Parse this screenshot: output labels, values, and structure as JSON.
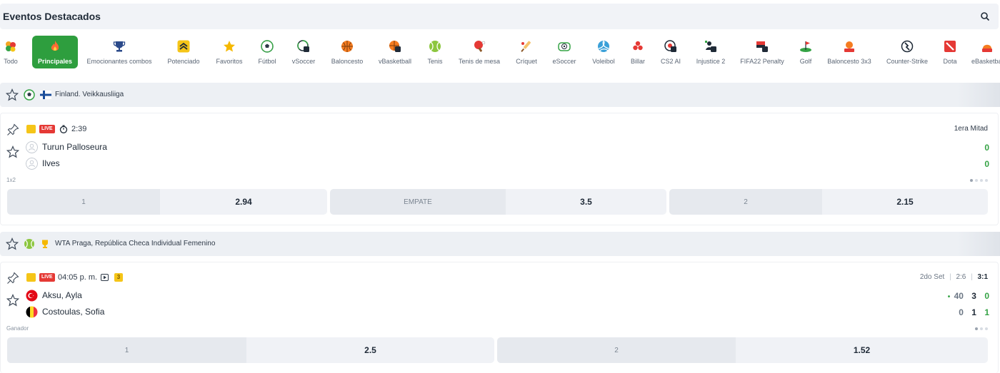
{
  "header": {
    "title": "Eventos Destacados"
  },
  "tabs": [
    {
      "label": "Todo",
      "icon": "all-sports-icon"
    },
    {
      "label": "Principales",
      "icon": "fire-icon"
    },
    {
      "label": "Emocionantes combos",
      "icon": "trophy-icon"
    },
    {
      "label": "Potenciado",
      "icon": "boost-icon"
    },
    {
      "label": "Favoritos",
      "icon": "star-icon"
    },
    {
      "label": "Fútbol",
      "icon": "soccer-ball-icon"
    },
    {
      "label": "vSoccer",
      "icon": "vsoccer-icon"
    },
    {
      "label": "Baloncesto",
      "icon": "basketball-icon"
    },
    {
      "label": "vBasketball",
      "icon": "vbasketball-icon"
    },
    {
      "label": "Tenis",
      "icon": "tennis-ball-icon"
    },
    {
      "label": "Tenis de mesa",
      "icon": "table-tennis-icon"
    },
    {
      "label": "Críquet",
      "icon": "cricket-icon"
    },
    {
      "label": "eSoccer",
      "icon": "esoccer-icon"
    },
    {
      "label": "Voleibol",
      "icon": "volleyball-icon"
    },
    {
      "label": "Billar",
      "icon": "billiards-icon"
    },
    {
      "label": "CS2 AI",
      "icon": "cs2-ai-icon"
    },
    {
      "label": "Injustice 2",
      "icon": "injustice-icon"
    },
    {
      "label": "FIFA22 Penalty",
      "icon": "fifa-icon"
    },
    {
      "label": "Golf",
      "icon": "golf-icon"
    },
    {
      "label": "Baloncesto 3x3",
      "icon": "basketball-3x3-icon"
    },
    {
      "label": "Counter-Strike",
      "icon": "counter-strike-icon"
    },
    {
      "label": "Dota",
      "icon": "dota-icon"
    },
    {
      "label": "eBasketball",
      "icon": "ebasketball-icon"
    }
  ],
  "league1": {
    "name": "Finland. Veikkausliiga"
  },
  "event1": {
    "live": "LIVE",
    "time": "2:39",
    "period": "1era Mitad",
    "team1": "Turun Palloseura",
    "team2": "Ilves",
    "score1": "0",
    "score2": "0",
    "market": "1x2",
    "odds": [
      {
        "label": "1",
        "value": "2.94"
      },
      {
        "label": "EMPATE",
        "value": "3.5"
      },
      {
        "label": "2",
        "value": "2.15"
      }
    ]
  },
  "league2": {
    "name": "WTA Praga, República Checa Individual Femenino"
  },
  "event2": {
    "live": "LIVE",
    "time": "04:05 p. m.",
    "count": "3",
    "set_label": "2do Set",
    "set_scores": "2:6",
    "set_current": "3:1",
    "sep": "|",
    "team1": "Aksu, Ayla",
    "team2": "Costoulas, Sofia",
    "p1_points": "40",
    "p1_games": "3",
    "p1_sets": "0",
    "p2_points": "0",
    "p2_games": "1",
    "p2_sets": "1",
    "serve_dot": "•",
    "market": "Ganador",
    "odds": [
      {
        "label": "1",
        "value": "2.5"
      },
      {
        "label": "2",
        "value": "1.52"
      }
    ]
  },
  "colors": {
    "accent": "#2e9e3e",
    "live": "#e53935",
    "score_green": "#35a345"
  }
}
